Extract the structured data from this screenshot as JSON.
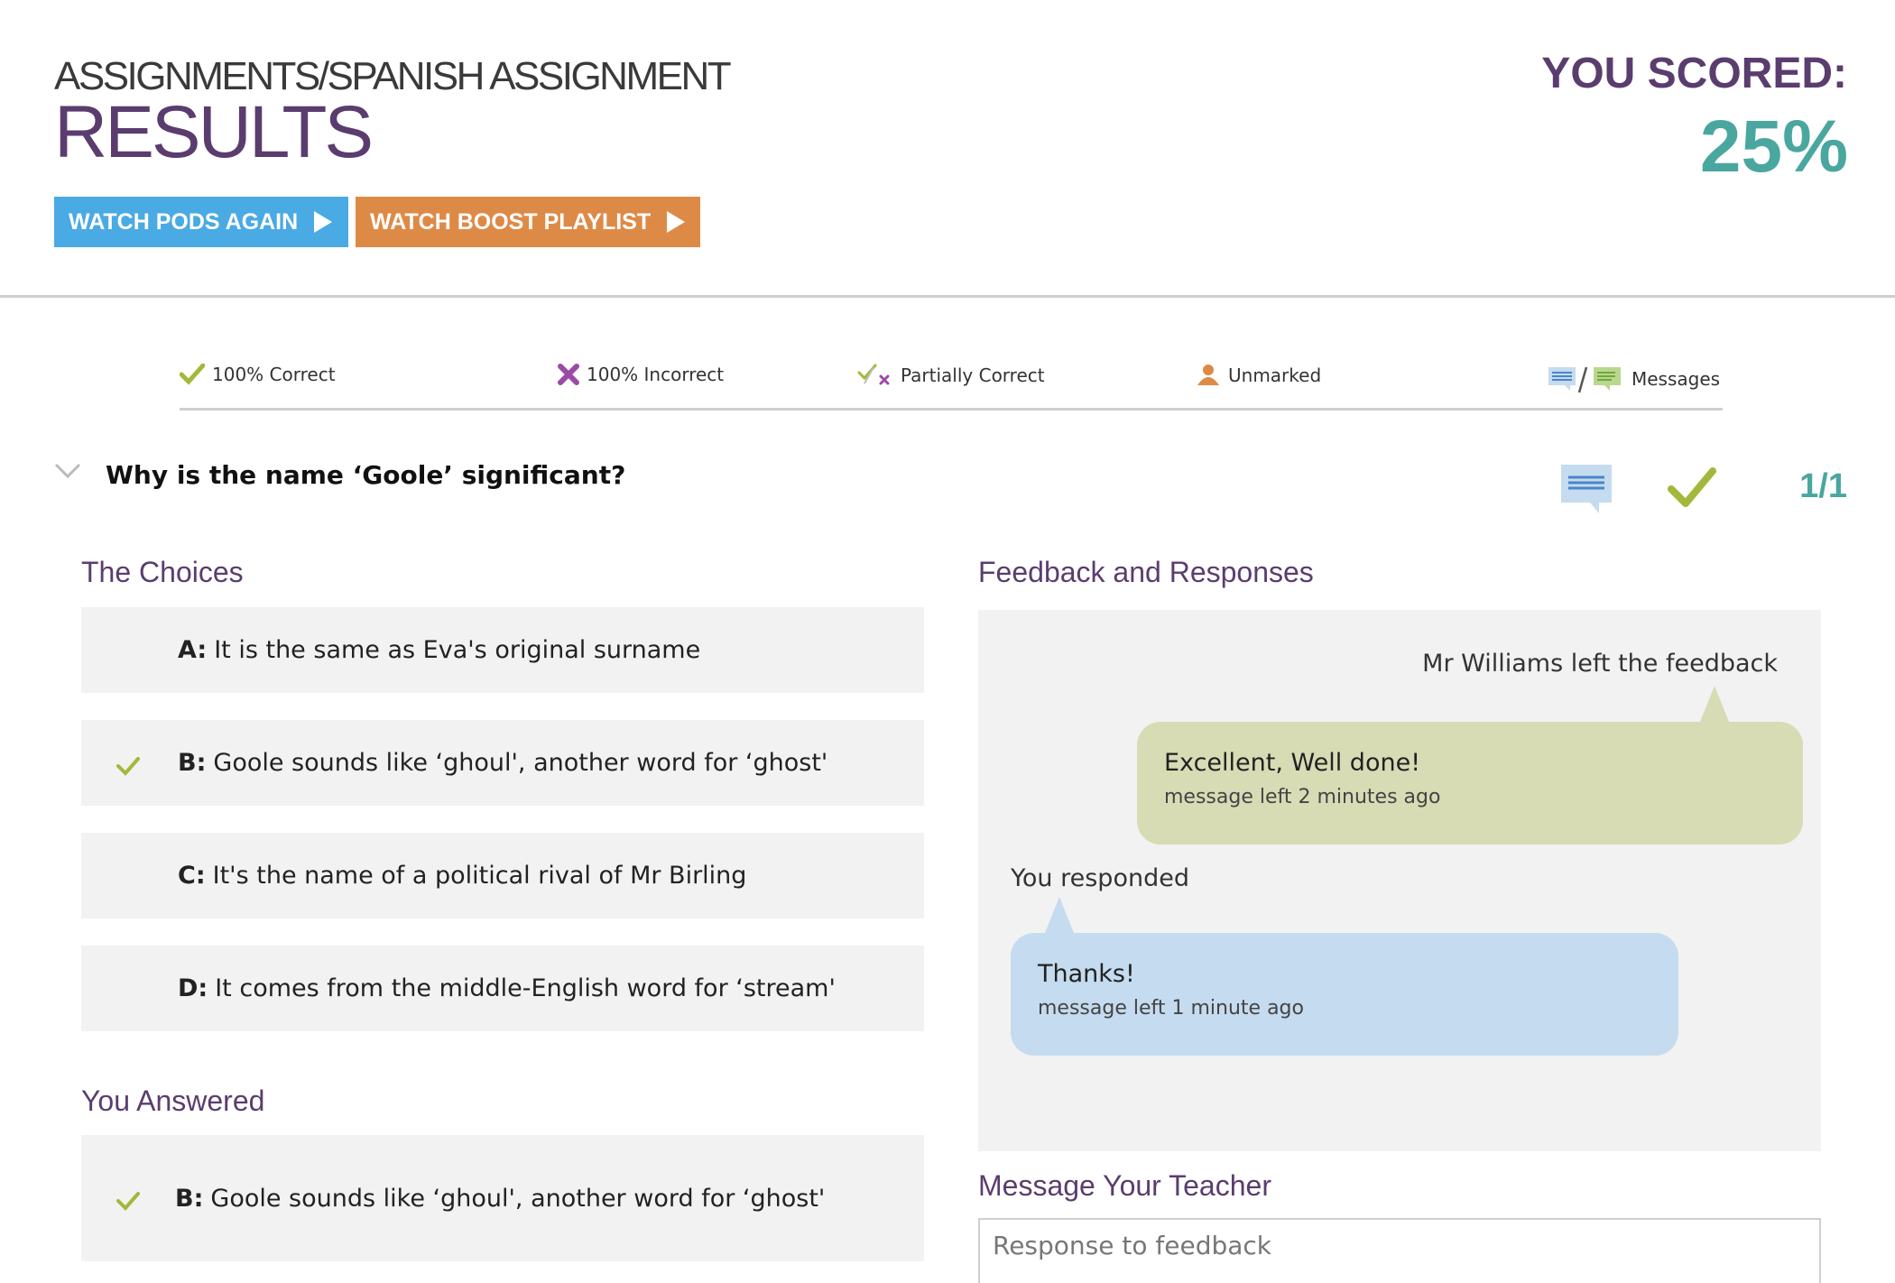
{
  "header": {
    "breadcrumb": "ASSIGNMENTS/SPANISH ASSIGNMENT",
    "title": "RESULTS",
    "watch_pods_label": "WATCH PODS AGAIN",
    "watch_boost_label": "WATCH BOOST PLAYLIST",
    "score_label": "YOU SCORED:",
    "score_value": "25%"
  },
  "legend": {
    "correct": "100% Correct",
    "incorrect": "100% Incorrect",
    "partial": "Partially Correct",
    "unmarked": "Unmarked",
    "messages": "Messages"
  },
  "question": {
    "text": "Why is the name ‘Goole’ significant?",
    "score": "1/1",
    "status_icon": "check-icon"
  },
  "choices": {
    "title": "The Choices",
    "items": [
      {
        "letter": "A:",
        "text": "It is the same as Eva's original surname",
        "correct": false
      },
      {
        "letter": "B:",
        "text": "Goole sounds like ‘ghoul', another word for ‘ghost'",
        "correct": true
      },
      {
        "letter": "C:",
        "text": "It's the name of a political rival of Mr Birling",
        "correct": false
      },
      {
        "letter": "D:",
        "text": "It comes from the middle-English word for ‘stream'",
        "correct": false
      }
    ]
  },
  "answered": {
    "title": "You Answered",
    "letter": "B:",
    "text": "Goole sounds like ‘ghoul', another word for ‘ghost'"
  },
  "feedback": {
    "title": "Feedback and Responses",
    "author_line": "Mr Williams left the feedback",
    "teacher_message": "Excellent, Well done!",
    "teacher_meta": "message left 2 minutes ago",
    "you_responded": "You responded",
    "student_message": "Thanks!",
    "student_meta": "message left 1 minute ago"
  },
  "message_teacher": {
    "title": "Message Your Teacher",
    "placeholder": "Response to feedback"
  },
  "colors": {
    "brand_purple": "#5a3d6e",
    "score_teal": "#4aa79f",
    "pods_blue": "#4aaae4",
    "boost_orange": "#de8a47",
    "check_green": "#a3b83a"
  }
}
